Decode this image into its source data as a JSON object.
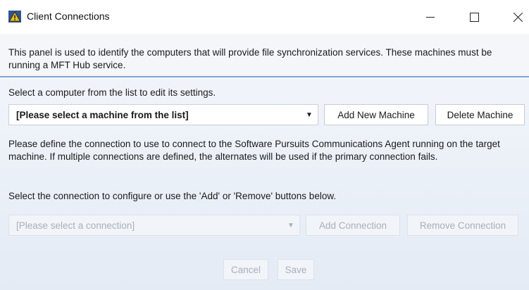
{
  "window": {
    "title": "Client Connections",
    "icon": "warning-triangle-icon",
    "minimize_symbol": "—",
    "maximize_symbol": "☐",
    "close_symbol": "✕"
  },
  "intro": {
    "text": "This panel is used to identify the computers that will provide file synchronization services. These machines must be running a MFT Hub service."
  },
  "machine": {
    "label": "Select a computer from the list to edit its settings.",
    "selected": "[Please select a machine from the list]",
    "add_button": "Add New Machine",
    "delete_button": "Delete Machine"
  },
  "connection": {
    "description": "Please define the connection to use to connect to the Software Pursuits Communications Agent running on the target machine. If multiple connections are defined, the alternates will be used if the primary connection fails.",
    "label": "Select the connection to configure or use the 'Add' or 'Remove' buttons below.",
    "selected": "[Please select a connection]",
    "add_button": "Add Connection",
    "remove_button": "Remove Connection"
  },
  "footer": {
    "cancel_button": "Cancel",
    "save_button": "Save"
  },
  "colors": {
    "accent_line": "#86a6d2",
    "disabled_text": "#a9b0bb"
  }
}
